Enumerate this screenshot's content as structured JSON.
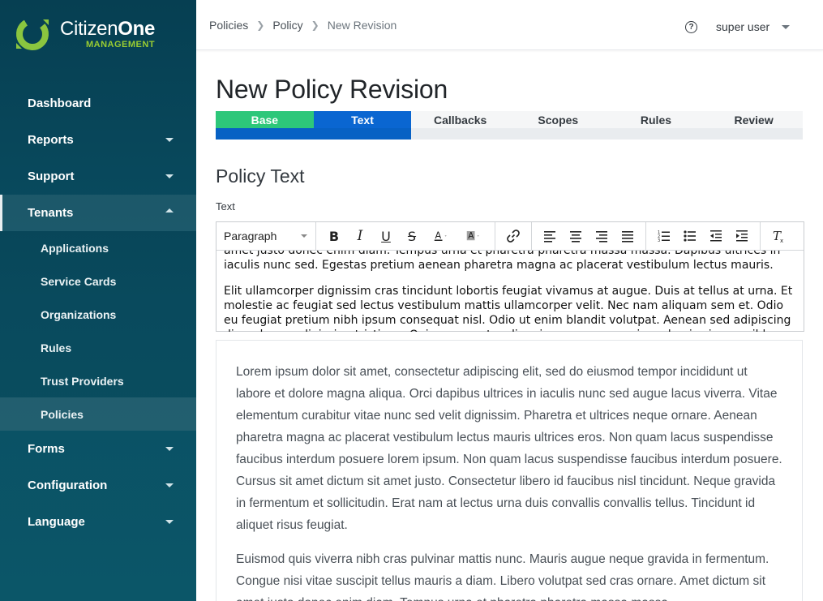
{
  "brand": {
    "name_main": "Citizen",
    "name_bold": "One",
    "subtitle": "MANAGEMENT",
    "accent": "#8bc53f"
  },
  "sidebar": {
    "items": [
      {
        "label": "Dashboard",
        "caret": "none"
      },
      {
        "label": "Reports",
        "caret": "down"
      },
      {
        "label": "Support",
        "caret": "down"
      },
      {
        "label": "Tenants",
        "caret": "up"
      },
      {
        "label": "Forms",
        "caret": "down"
      },
      {
        "label": "Configuration",
        "caret": "down"
      },
      {
        "label": "Language",
        "caret": "down"
      }
    ],
    "tenants_sub": [
      "Applications",
      "Service Cards",
      "Organizations",
      "Rules",
      "Trust Providers",
      "Policies"
    ]
  },
  "header": {
    "breadcrumb": [
      "Policies",
      "Policy",
      "New Revision"
    ],
    "help_icon": "?",
    "user": "super user"
  },
  "page": {
    "title": "New Policy Revision",
    "steps": [
      {
        "label": "Base",
        "state": "done"
      },
      {
        "label": "Text",
        "state": "active"
      },
      {
        "label": "Callbacks",
        "state": "todo"
      },
      {
        "label": "Scopes",
        "state": "todo"
      },
      {
        "label": "Rules",
        "state": "todo"
      },
      {
        "label": "Review",
        "state": "todo"
      }
    ],
    "section_title": "Policy Text",
    "field_label": "Text"
  },
  "editor": {
    "block_format": "Paragraph",
    "toolbar_icons": [
      "bold-icon",
      "italic-icon",
      "underline-icon",
      "strikethrough-icon",
      "text-color-icon",
      "background-color-icon",
      "link-icon",
      "align-left-icon",
      "align-center-icon",
      "align-right-icon",
      "align-justify-icon",
      "ordered-list-icon",
      "bullet-list-icon",
      "outdent-icon",
      "indent-icon",
      "clear-formatting-icon"
    ],
    "content": {
      "p1_line1": "amet justo donec enim diam. Tempus urna et pharetra pharetra massa massa. Dapibus ultrices in",
      "p1_line2": "iaculis nunc sed. Egestas pretium aenean pharetra magna ac placerat vestibulum lectus mauris.",
      "p2": "Elit ullamcorper dignissim cras tincidunt lobortis feugiat vivamus at augue. Duis at tellus at urna. Et molestie ac feugiat sed lectus vestibulum mattis ullamcorper velit. Nec nam aliquam sem et. Odio eu feugiat pretium nibh ipsum consequat nisl. Odio ut enim blandit volutpat. Aenean sed adipiscing diam donec adipiscing tristique. Quisque egestas diam in arcu cursus euismod quis viverra nibh."
    }
  },
  "preview": {
    "paragraphs": [
      "Lorem ipsum dolor sit amet, consectetur adipiscing elit, sed do eiusmod tempor incididunt ut labore et dolore magna aliqua. Orci dapibus ultrices in iaculis nunc sed augue lacus viverra. Vitae elementum curabitur vitae nunc sed velit dignissim. Pharetra et ultrices neque ornare. Aenean pharetra magna ac placerat vestibulum lectus mauris ultrices eros. Non quam lacus suspendisse faucibus interdum posuere lorem ipsum. Non quam lacus suspendisse faucibus interdum posuere. Cursus sit amet dictum sit amet justo. Consectetur libero id faucibus nisl tincidunt. Neque gravida in fermentum et sollicitudin. Erat nam at lectus urna duis convallis convallis tellus. Tincidunt id aliquet risus feugiat.",
      "Euismod quis viverra nibh cras pulvinar mattis nunc. Mauris augue neque gravida in fermentum. Congue nisi vitae suscipit tellus mauris a diam. Libero volutpat sed cras ornare. Amet dictum sit amet justo donec enim diam. Tempus urna et pharetra pharetra massa massa."
    ]
  },
  "colors": {
    "sidebar_top": "#063f52",
    "sidebar_bottom": "#0b5668",
    "step_done": "#2dc77a",
    "step_active": "#0a66d1"
  }
}
